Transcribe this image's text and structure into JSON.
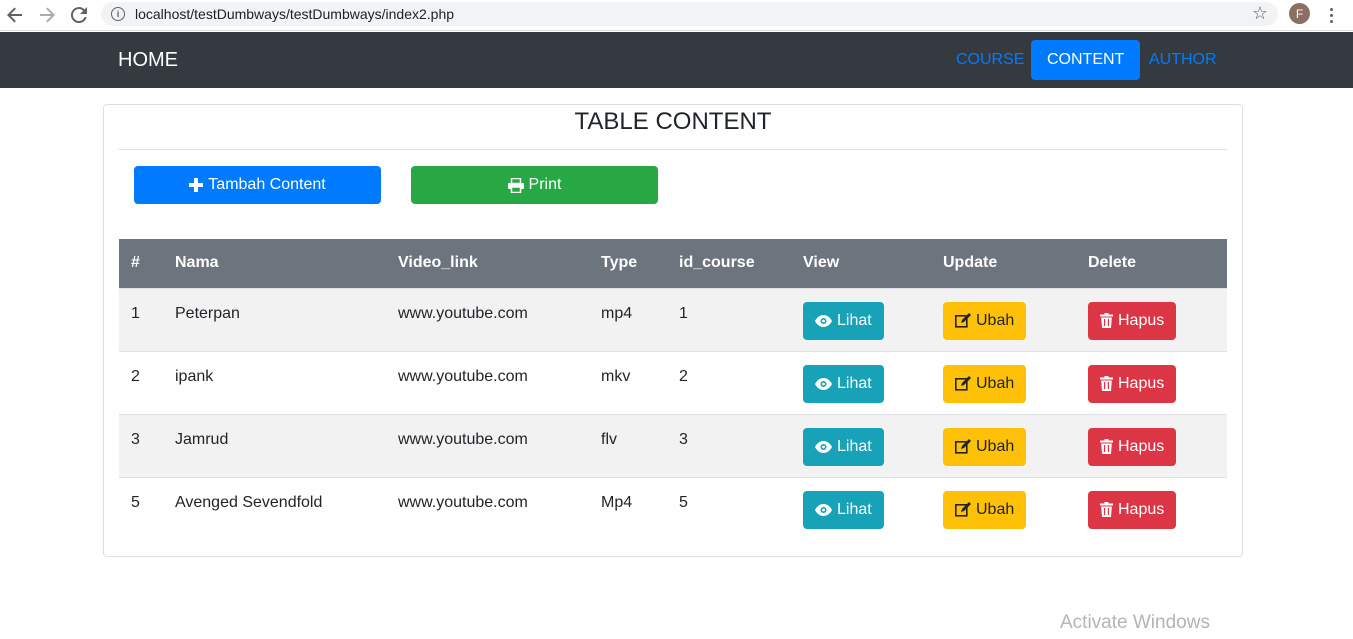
{
  "browser": {
    "url": "localhost/testDumbways/testDumbways/index2.php",
    "profile_initial": "F"
  },
  "navbar": {
    "brand": "HOME",
    "links": [
      {
        "label": "COURSE",
        "active": false
      },
      {
        "label": "CONTENT",
        "active": true
      },
      {
        "label": "AUTHOR",
        "active": false
      }
    ]
  },
  "card": {
    "title": "TABLE CONTENT",
    "add_button": "Tambah Content",
    "print_button": "Print"
  },
  "table": {
    "headers": [
      "#",
      "Nama",
      "Video_link",
      "Type",
      "id_course",
      "View",
      "Update",
      "Delete"
    ],
    "rows": [
      {
        "no": "1",
        "nama": "Peterpan",
        "video_link": "www.youtube.com",
        "type": "mp4",
        "id_course": "1"
      },
      {
        "no": "2",
        "nama": "ipank",
        "video_link": "www.youtube.com",
        "type": "mkv",
        "id_course": "2"
      },
      {
        "no": "3",
        "nama": "Jamrud",
        "video_link": "www.youtube.com",
        "type": "flv",
        "id_course": "3"
      },
      {
        "no": "5",
        "nama": "Avenged Sevendfold",
        "video_link": "www.youtube.com",
        "type": "Mp4",
        "id_course": "5"
      }
    ],
    "view_label": "Lihat",
    "update_label": "Ubah",
    "delete_label": "Hapus"
  },
  "watermark": "Activate Windows",
  "colors": {
    "navbar": "#343a40",
    "primary": "#007bff",
    "success": "#28a745",
    "info": "#17a2b8",
    "warning": "#ffc107",
    "danger": "#dc3545",
    "table_header": "#6c757d"
  }
}
